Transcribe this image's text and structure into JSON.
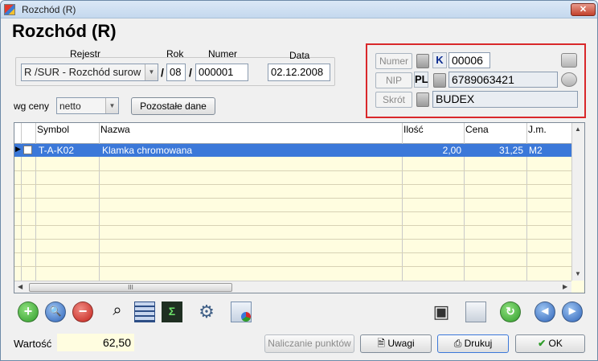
{
  "window": {
    "title": "Rozchód (R)",
    "close": "✕"
  },
  "heading": "Rozchód (R)",
  "labels": {
    "rejestr": "Rejestr",
    "rok": "Rok",
    "numer": "Numer",
    "data": "Data",
    "wg_ceny": "wg ceny",
    "sep1": "/",
    "sep2": "/"
  },
  "fields": {
    "rejestr": "R /SUR - Rozchód surow",
    "rok": "08",
    "numer": "000001",
    "data": "02.12.2008",
    "wg_ceny": "netto"
  },
  "buttons": {
    "pozostale": "Pozostałe dane",
    "naliczanie": "Naliczanie punktów",
    "uwagi": "Uwagi",
    "drukuj": "Drukuj",
    "ok": "OK"
  },
  "kontrahent": {
    "numer_btn": "Numer",
    "nip_btn": "NIP",
    "skrot_btn": "Skrót",
    "type_code": "K",
    "numer": "00006",
    "country_code": "PL",
    "nip": "6789063421",
    "skrot": "BUDEX"
  },
  "table": {
    "columns": [
      "Symbol",
      "Nazwa",
      "Ilość",
      "Cena",
      "J.m."
    ],
    "rows": [
      {
        "symbol": "T-A-K02",
        "nazwa": "Klamka chromowana",
        "ilosc": "2,00",
        "cena": "31,25",
        "jm": "M2"
      }
    ],
    "scroll_grip": "III"
  },
  "footer": {
    "wartosc_label": "Wartość",
    "wartosc_value": "62,50"
  },
  "icons": {
    "add": "plus-icon",
    "find": "magnifier-icon",
    "remove": "minus-icon",
    "binoculars": "binoculars-icon",
    "calc": "calculator-icon",
    "sum": "sum-icon",
    "gears": "gears-icon",
    "chart": "chart-icon",
    "save": "floppy-icon",
    "copy": "copy-icon",
    "refresh": "refresh-icon",
    "prev": "prev-icon",
    "next": "next-icon"
  },
  "colors": {
    "accent": "#3b78d9",
    "highlight_border": "#d9282a",
    "grid_bg": "#fffde0"
  }
}
